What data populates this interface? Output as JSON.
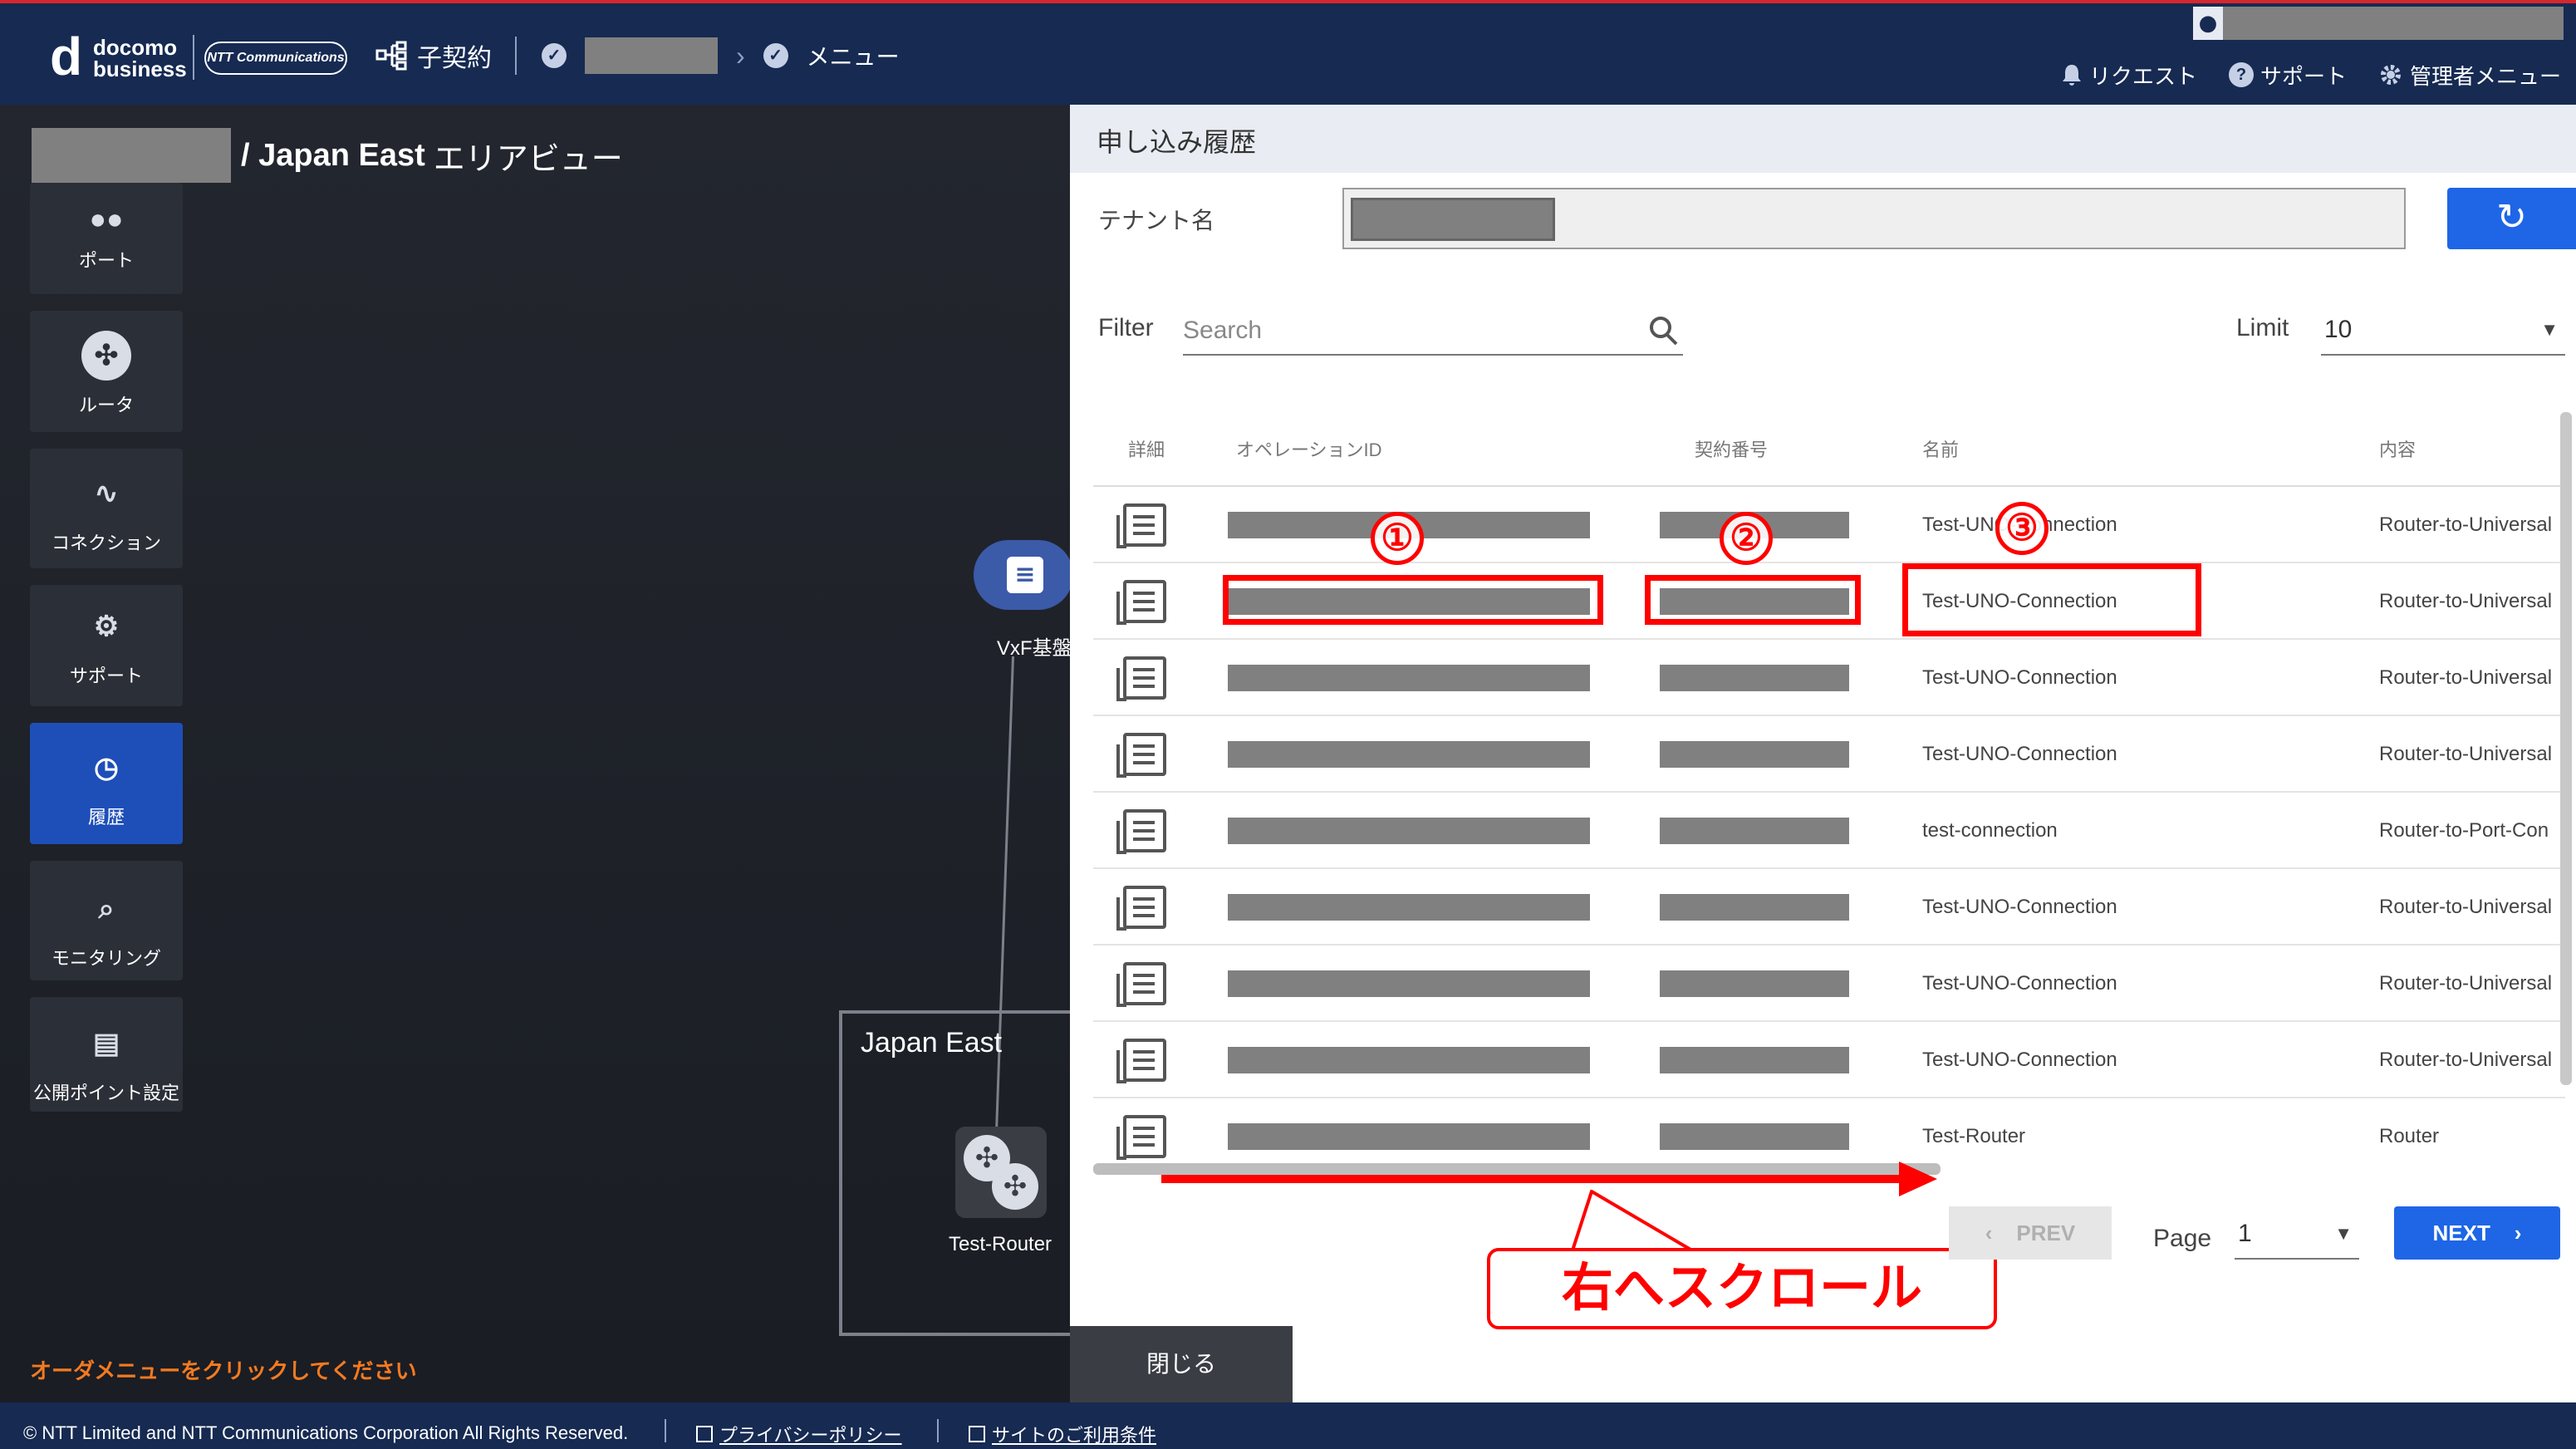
{
  "header": {
    "brand_mark": "d",
    "brand_line1": "docomo",
    "brand_line2": "business",
    "partner_logo": "NTT Communications",
    "sub_contract": "子契約",
    "crumb_menu": "メニュー",
    "top_menu": {
      "request": "リクエスト",
      "support": "サポート",
      "admin": "管理者メニュー"
    }
  },
  "area": {
    "title": "/ Japan East",
    "view": "エリアビュー",
    "order_hint": "オーダメニューをクリックしてください",
    "cloud_label": "VxF基盤",
    "region_label": "Japan East",
    "router_label": "Test-Router"
  },
  "sidebar": {
    "items": [
      {
        "label": "ポート",
        "icon": "port-icon"
      },
      {
        "label": "ルータ",
        "icon": "router-icon"
      },
      {
        "label": "コネクション",
        "icon": "connection-icon"
      },
      {
        "label": "サポート",
        "icon": "support-icon"
      },
      {
        "label": "履歴",
        "icon": "history-icon"
      },
      {
        "label": "モニタリング",
        "icon": "monitoring-icon"
      },
      {
        "label": "公開ポイント設定",
        "icon": "public-point-icon"
      }
    ]
  },
  "panel": {
    "title": "申し込み履歴",
    "tenant_label": "テナント名",
    "filter_label": "Filter",
    "search_placeholder": "Search",
    "limit_label": "Limit",
    "limit_value": "10",
    "columns": [
      "詳細",
      "オペレーションID",
      "契約番号",
      "名前",
      "内容"
    ],
    "rows": [
      {
        "name": "Test-UNO-Connection",
        "content": "Router-to-Universal"
      },
      {
        "name": "Test-UNO-Connection",
        "content": "Router-to-Universal"
      },
      {
        "name": "Test-UNO-Connection",
        "content": "Router-to-Universal"
      },
      {
        "name": "Test-UNO-Connection",
        "content": "Router-to-Universal"
      },
      {
        "name": "test-connection",
        "content": "Router-to-Port-Con"
      },
      {
        "name": "Test-UNO-Connection",
        "content": "Router-to-Universal"
      },
      {
        "name": "Test-UNO-Connection",
        "content": "Router-to-Universal"
      },
      {
        "name": "Test-UNO-Connection",
        "content": "Router-to-Universal"
      },
      {
        "name": "Test-Router",
        "content": "Router"
      }
    ],
    "prev_label": "PREV",
    "page_label": "Page",
    "page_value": "1",
    "next_label": "NEXT",
    "close_label": "閉じる"
  },
  "annotations": {
    "mark1": "①",
    "mark2": "②",
    "mark3": "③",
    "callout": "右へスクロール",
    "color": "#ff0000"
  },
  "footer": {
    "copyright": "© NTT Limited and NTT Communications Corporation All Rights Reserved.",
    "privacy": "プライバシーポリシー",
    "terms": "サイトのご利用条件"
  },
  "colors": {
    "header_bg": "#162a52",
    "accent": "#1e66e6",
    "active_menu": "#1e4fb8",
    "hint": "#f47a20"
  }
}
